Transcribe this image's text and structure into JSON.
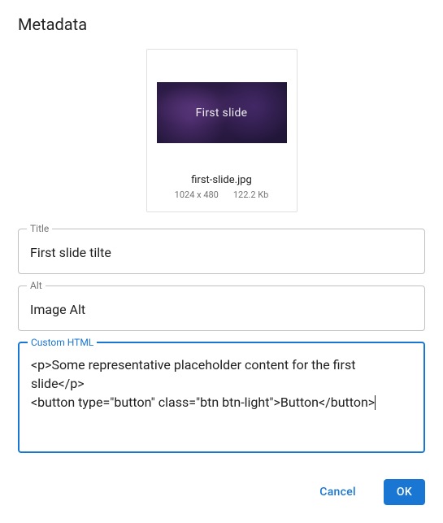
{
  "header": {
    "title": "Metadata"
  },
  "preview": {
    "slide_label": "First slide",
    "filename": "first-slide.jpg",
    "dimensions": "1024 x 480",
    "filesize": "122.2 Kb"
  },
  "fields": {
    "title": {
      "label": "Title",
      "value": "First slide tilte"
    },
    "alt": {
      "label": "Alt",
      "value": "Image Alt"
    },
    "custom_html": {
      "label": "Custom HTML",
      "value": "<p>Some representative placeholder content for the first slide</p>\n<button type=\"button\" class=\"btn btn-light\">Button</button>"
    }
  },
  "actions": {
    "cancel": "Cancel",
    "ok": "OK"
  }
}
